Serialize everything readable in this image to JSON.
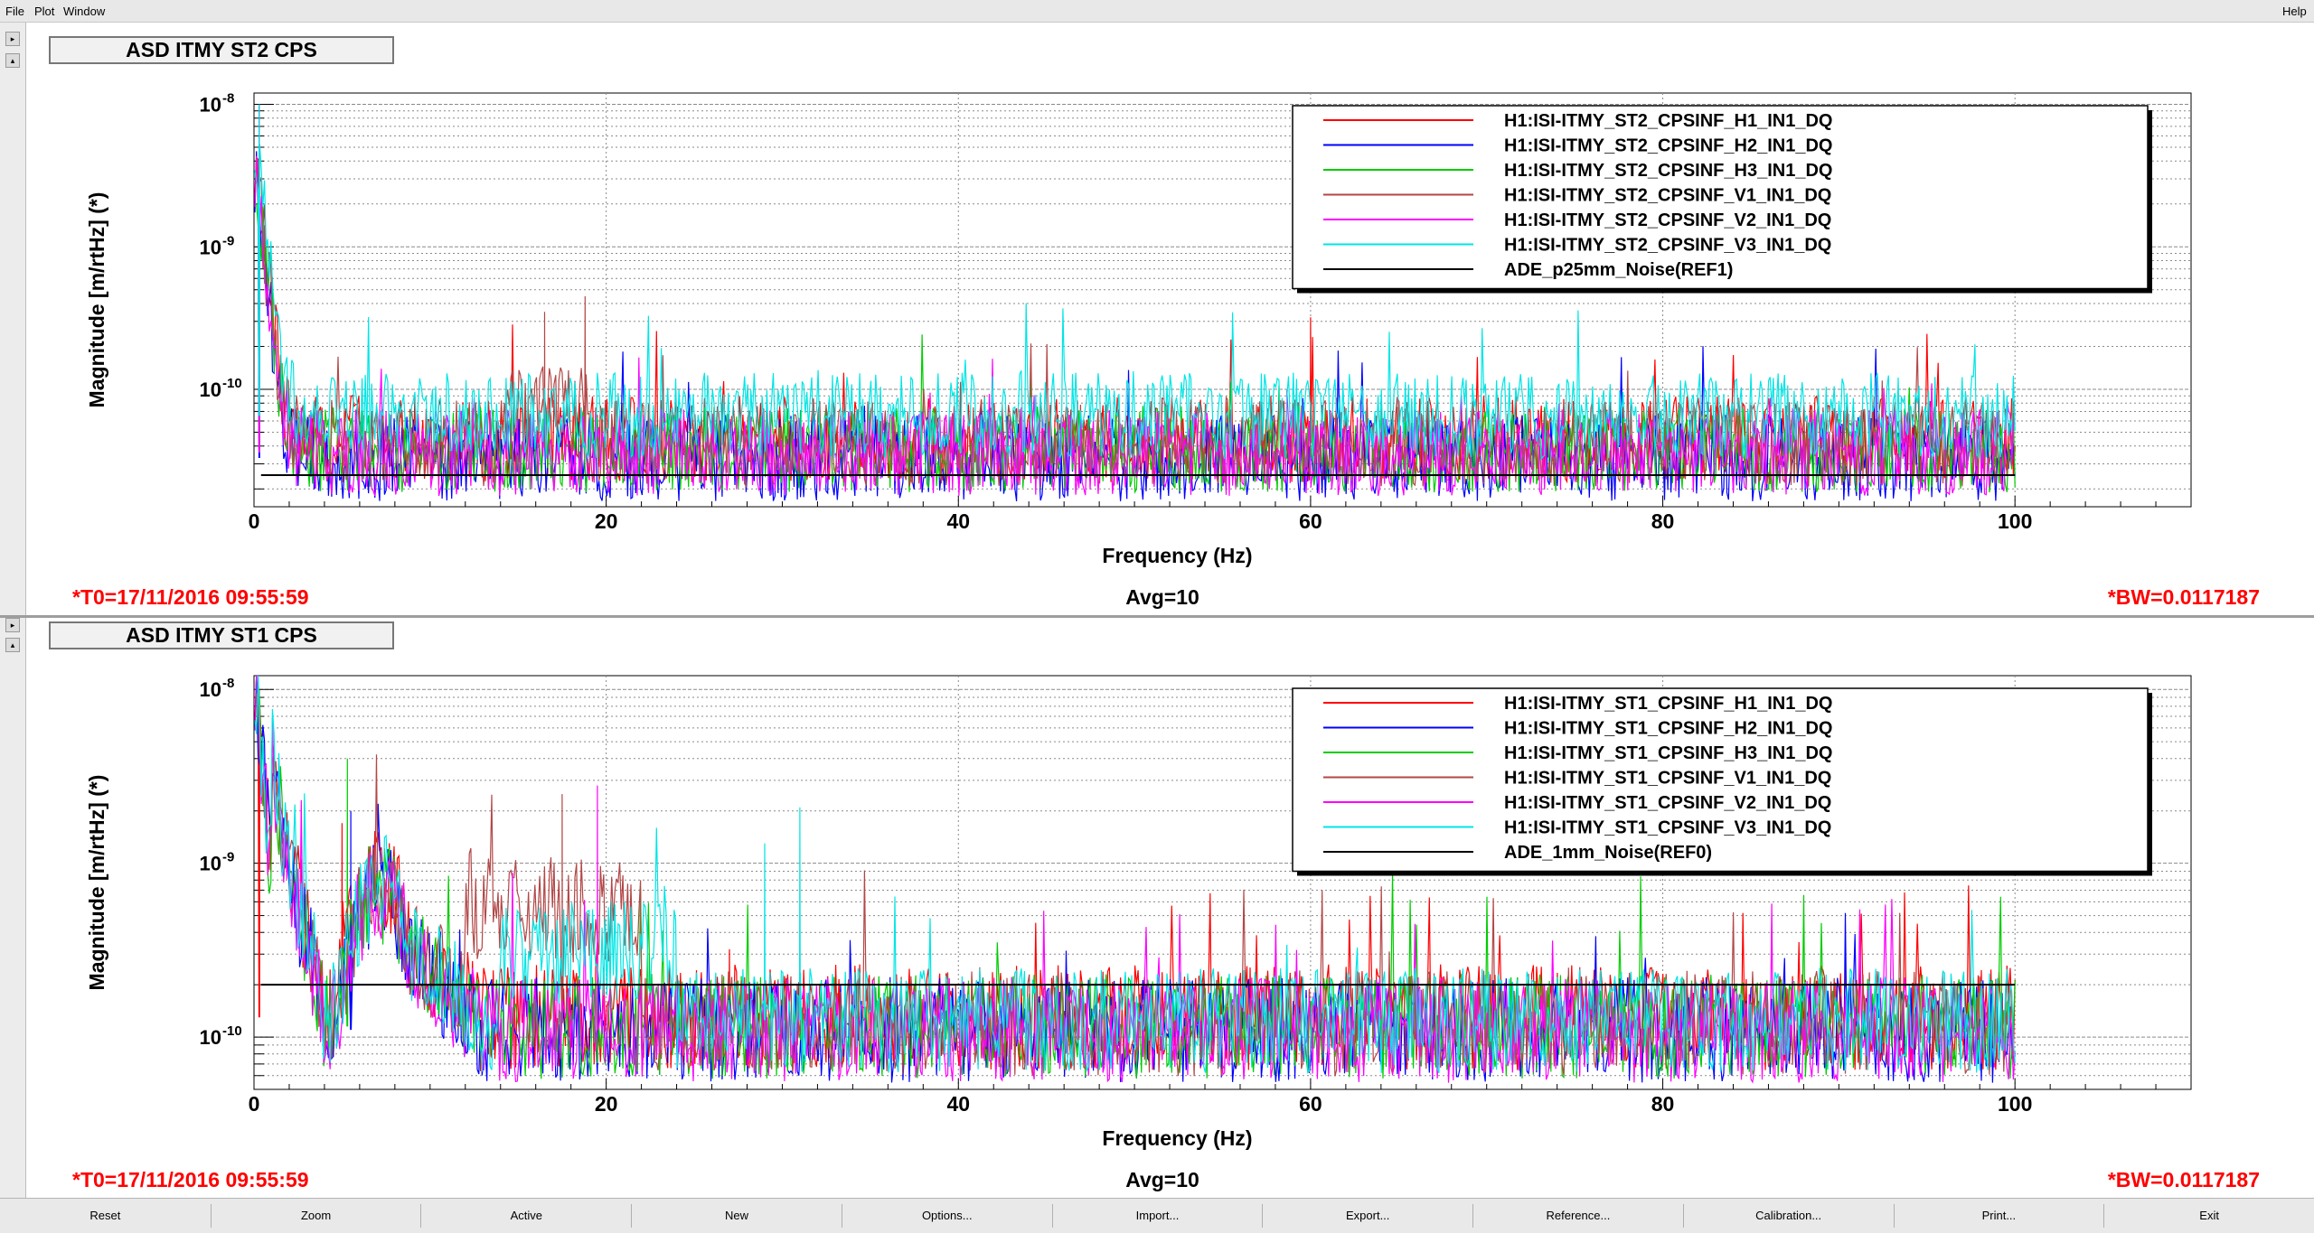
{
  "menu": {
    "file": "File",
    "plot": "Plot",
    "window": "Window",
    "help": "Help"
  },
  "panels": [
    {
      "title": "ASD ITMY ST2 CPS",
      "t0": "*T0=17/11/2016 09:55:59",
      "avg": "Avg=10",
      "bw": "*BW=0.0117187",
      "legend": [
        "H1:ISI-ITMY_ST2_CPSINF_H1_IN1_DQ",
        "H1:ISI-ITMY_ST2_CPSINF_H2_IN1_DQ",
        "H1:ISI-ITMY_ST2_CPSINF_H3_IN1_DQ",
        "H1:ISI-ITMY_ST2_CPSINF_V1_IN1_DQ",
        "H1:ISI-ITMY_ST2_CPSINF_V2_IN1_DQ",
        "H1:ISI-ITMY_ST2_CPSINF_V3_IN1_DQ",
        "ADE_p25mm_Noise(REF1)"
      ]
    },
    {
      "title": "ASD ITMY ST1 CPS",
      "t0": "*T0=17/11/2016 09:55:59",
      "avg": "Avg=10",
      "bw": "*BW=0.0117187",
      "legend": [
        "H1:ISI-ITMY_ST1_CPSINF_H1_IN1_DQ",
        "H1:ISI-ITMY_ST1_CPSINF_H2_IN1_DQ",
        "H1:ISI-ITMY_ST1_CPSINF_H3_IN1_DQ",
        "H1:ISI-ITMY_ST1_CPSINF_V1_IN1_DQ",
        "H1:ISI-ITMY_ST1_CPSINF_V2_IN1_DQ",
        "H1:ISI-ITMY_ST1_CPSINF_V3_IN1_DQ",
        "ADE_1mm_Noise(REF0)"
      ]
    }
  ],
  "chart_data": [
    {
      "type": "line",
      "title": "ASD ITMY ST2 CPS",
      "xlabel": "Frequency (Hz)",
      "ylabel": "Magnitude [m/rtHz] (*)",
      "xlim": [
        0,
        110
      ],
      "ylim": [
        1.5e-11,
        1.2e-08
      ],
      "yscale": "log",
      "grid": true,
      "legend_position": "top-right",
      "x_ticks": [
        "0",
        "20",
        "40",
        "60",
        "80",
        "100"
      ],
      "y_ticks": [
        {
          "exp": "-8"
        },
        {
          "exp": "-9"
        },
        {
          "exp": "-10"
        }
      ],
      "series": [
        {
          "name": "H1:ISI-ITMY_ST2_CPSINF_H1_IN1_DQ",
          "color": "#ff0000",
          "noise_floor": 4.5e-11,
          "spikes": [
            [
              60,
              3.2e-10
            ],
            [
              0.3,
              1e-08
            ]
          ]
        },
        {
          "name": "H1:ISI-ITMY_ST2_CPSINF_H2_IN1_DQ",
          "color": "#0000ff",
          "noise_floor": 3.3e-11,
          "spikes": [
            [
              0.3,
              1e-08
            ]
          ]
        },
        {
          "name": "H1:ISI-ITMY_ST2_CPSINF_H3_IN1_DQ",
          "color": "#00cc00",
          "noise_floor": 3.8e-11,
          "spikes": [
            [
              0.3,
              1e-08
            ]
          ]
        },
        {
          "name": "H1:ISI-ITMY_ST2_CPSINF_V1_IN1_DQ",
          "color": "#b34747",
          "noise_floor": 4.2e-11,
          "spikes": [
            [
              16.5,
              3.5e-10
            ],
            [
              18.8,
              4.5e-10
            ]
          ]
        },
        {
          "name": "H1:ISI-ITMY_ST2_CPSINF_V2_IN1_DQ",
          "color": "#ff00ff",
          "noise_floor": 3.6e-11,
          "spikes": [
            [
              0.3,
              1e-08
            ]
          ]
        },
        {
          "name": "H1:ISI-ITMY_ST2_CPSINF_V3_IN1_DQ",
          "color": "#00e5e5",
          "noise_floor": 6.5e-11,
          "spikes": [
            [
              0.3,
              1e-08
            ]
          ]
        },
        {
          "name": "ADE_p25mm_Noise(REF1)",
          "color": "#000000",
          "value": 2.5e-11
        }
      ]
    },
    {
      "type": "line",
      "title": "ASD ITMY ST1 CPS",
      "xlabel": "Frequency (Hz)",
      "ylabel": "Magnitude [m/rtHz] (*)",
      "xlim": [
        0,
        110
      ],
      "ylim": [
        5e-11,
        1.2e-08
      ],
      "yscale": "log",
      "grid": true,
      "legend_position": "top-right",
      "x_ticks": [
        "0",
        "20",
        "40",
        "60",
        "80",
        "100"
      ],
      "y_ticks": [
        {
          "exp": "-8"
        },
        {
          "exp": "-9"
        },
        {
          "exp": "-10"
        }
      ],
      "series": [
        {
          "name": "H1:ISI-ITMY_ST1_CPSINF_H1_IN1_DQ",
          "color": "#ff0000",
          "noise_floor": 1.3e-10,
          "spikes": [
            [
              0.3,
              1e-08
            ],
            [
              5,
              1.7e-09
            ],
            [
              27,
              3.2e-10
            ]
          ]
        },
        {
          "name": "H1:ISI-ITMY_ST1_CPSINF_H2_IN1_DQ",
          "color": "#0000ff",
          "noise_floor": 1.1e-10,
          "spikes": [
            [
              5.5,
              2e-09
            ]
          ]
        },
        {
          "name": "H1:ISI-ITMY_ST1_CPSINF_H3_IN1_DQ",
          "color": "#00cc00",
          "noise_floor": 1.15e-10,
          "spikes": [
            [
              5.3,
              4e-09
            ]
          ]
        },
        {
          "name": "H1:ISI-ITMY_ST1_CPSINF_V1_IN1_DQ",
          "color": "#b34747",
          "noise_floor": 1.2e-10,
          "spikes": [
            [
              17.5,
              2.5e-09
            ]
          ]
        },
        {
          "name": "H1:ISI-ITMY_ST1_CPSINF_V2_IN1_DQ",
          "color": "#ff00ff",
          "noise_floor": 1.1e-10,
          "spikes": [
            [
              19.5,
              2.8e-09
            ]
          ]
        },
        {
          "name": "H1:ISI-ITMY_ST1_CPSINF_V3_IN1_DQ",
          "color": "#00e5e5",
          "noise_floor": 1.25e-10,
          "spikes": [
            [
              31,
              2.1e-09
            ],
            [
              29,
              1.3e-09
            ]
          ]
        },
        {
          "name": "ADE_1mm_Noise(REF0)",
          "color": "#000000",
          "value": 2e-10
        }
      ]
    }
  ],
  "buttons": [
    "Reset",
    "Zoom",
    "Active",
    "New",
    "Options...",
    "Import...",
    "Export...",
    "Reference...",
    "Calibration...",
    "Print...",
    "Exit"
  ]
}
